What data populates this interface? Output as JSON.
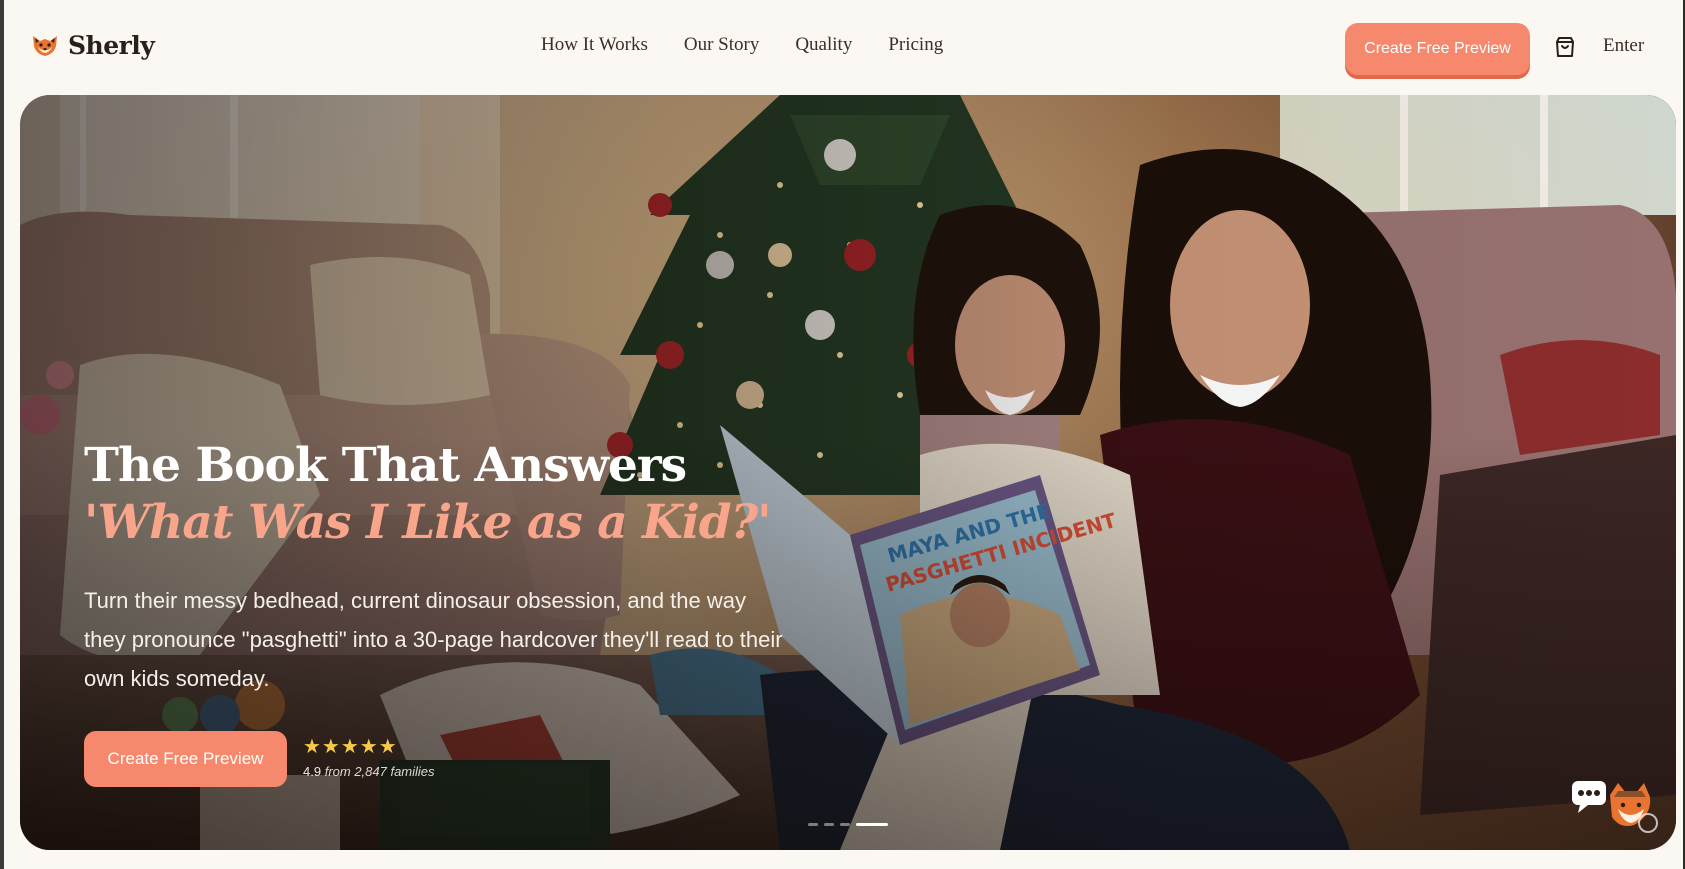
{
  "brand": {
    "name": "Sherly",
    "logo_icon": "fox-icon"
  },
  "nav": {
    "items": [
      {
        "label": "How It Works"
      },
      {
        "label": "Our Story"
      },
      {
        "label": "Quality"
      },
      {
        "label": "Pricing"
      }
    ]
  },
  "header": {
    "cta_label": "Create Free Preview",
    "cart_icon": "shopping-bag-icon",
    "enter_label": "Enter"
  },
  "hero": {
    "title": "The Book That Answers",
    "title_accent": "'What Was I Like as a Kid?'",
    "subtitle": "Turn their messy bedhead, current dinosaur obsession, and the way they pronounce \"pasghetti\" into a 30-page hardcover they'll read to their own kids someday.",
    "cta_label": "Create Free Preview",
    "rating": {
      "stars": "★★★★★",
      "score": "4.9",
      "note": "from 2,847 families"
    },
    "book_cover_title": "MAYA AND THE PASGHETTI INCIDENT",
    "slides": {
      "count": 4,
      "active_index": 3
    }
  },
  "chat_widget": {
    "icon": "chat-bubble-fox-icon"
  },
  "colors": {
    "accent": "#f6896d",
    "accent_text": "#f8a58c",
    "background": "#fbf8f4",
    "star": "#f7c948"
  }
}
